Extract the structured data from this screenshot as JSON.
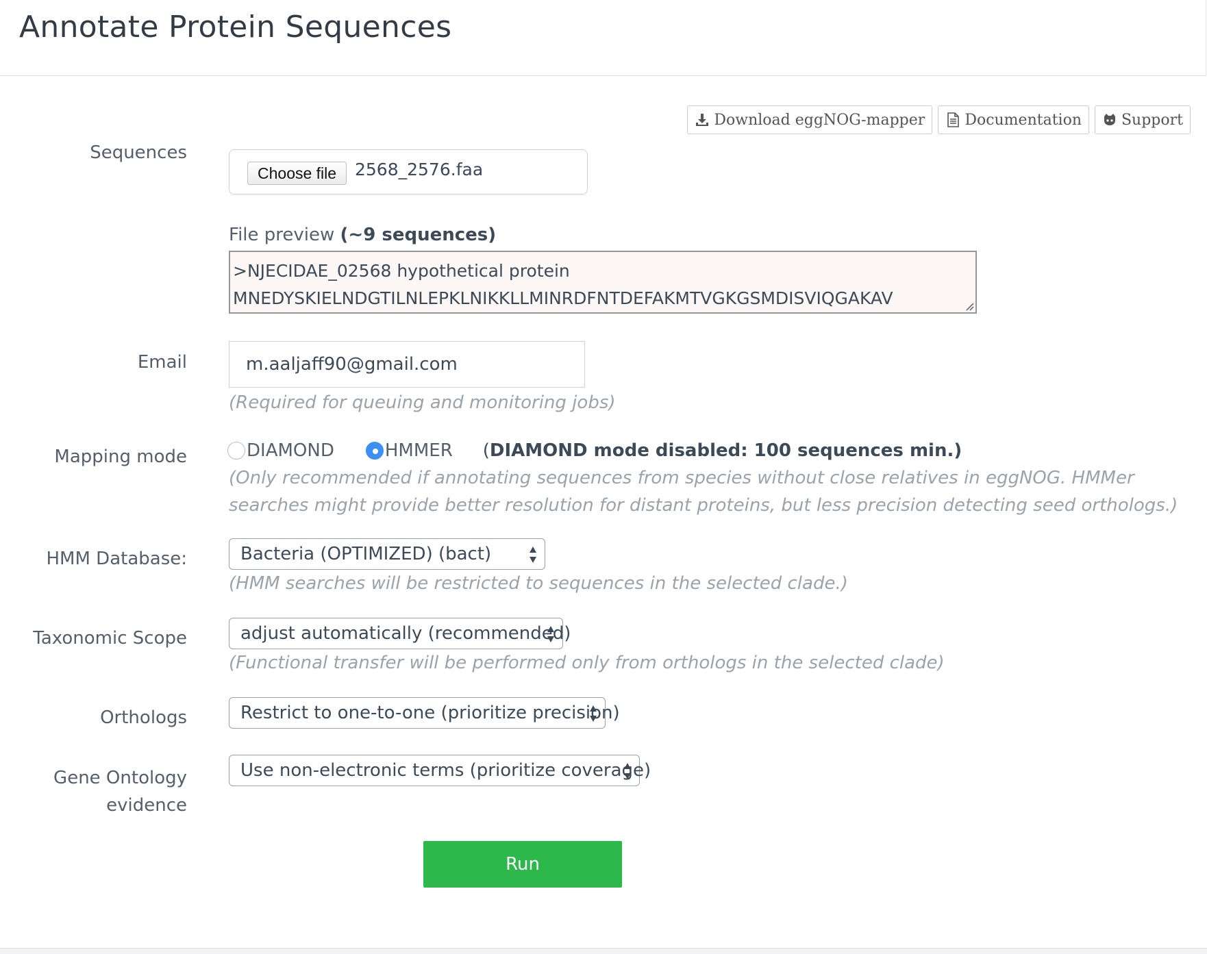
{
  "header": {
    "title": "Annotate Protein Sequences"
  },
  "toolbar": {
    "download_label": "Download eggNOG-mapper",
    "docs_label": "Documentation",
    "support_label": "Support"
  },
  "sequences": {
    "label": "Sequences",
    "choose_file_label": "Choose file",
    "file_name": "2568_2576.faa"
  },
  "preview": {
    "caption_prefix": "File preview ",
    "caption_count": "(~9 sequences)",
    "line1": ">NJECIDAE_02568 hypothetical protein",
    "line2": "MNEDYSKIELNDGTILNLEPKLNIKKLLMINRDFNTDEFAKMTVGKGSMDISVIQGAKAV"
  },
  "email": {
    "label": "Email",
    "value": "m.aaljaff90@gmail.com",
    "hint": "(Required for queuing and monitoring jobs)"
  },
  "mapping": {
    "label": "Mapping mode",
    "options": [
      "DIAMOND",
      "HMMER"
    ],
    "selected": "HMMER",
    "note_paren_open": "(",
    "note_bold": "DIAMOND mode disabled: 100 sequences min.)",
    "hint": "(Only recommended if annotating sequences from species without close relatives in eggNOG. HMMer searches might provide better resolution for distant proteins, but less precision detecting seed orthologs.)"
  },
  "hmm_db": {
    "label": "HMM Database:",
    "value": "Bacteria (OPTIMIZED) (bact)",
    "hint": "(HMM searches will be restricted to sequences in the selected clade.)"
  },
  "tax_scope": {
    "label": "Taxonomic Scope",
    "value": "adjust automatically (recommended)",
    "hint": "(Functional transfer will be performed only from orthologs in the selected clade)"
  },
  "orthologs": {
    "label": "Orthologs",
    "value": "Restrict to one-to-one (prioritize precision)"
  },
  "go_evidence": {
    "label_line1": "Gene Ontology",
    "label_line2": "evidence",
    "value": "Use non-electronic terms (prioritize coverage)"
  },
  "run": {
    "label": "Run"
  },
  "colors": {
    "run_button": "#2db84b",
    "radio_checked": "#3d8ff5"
  }
}
